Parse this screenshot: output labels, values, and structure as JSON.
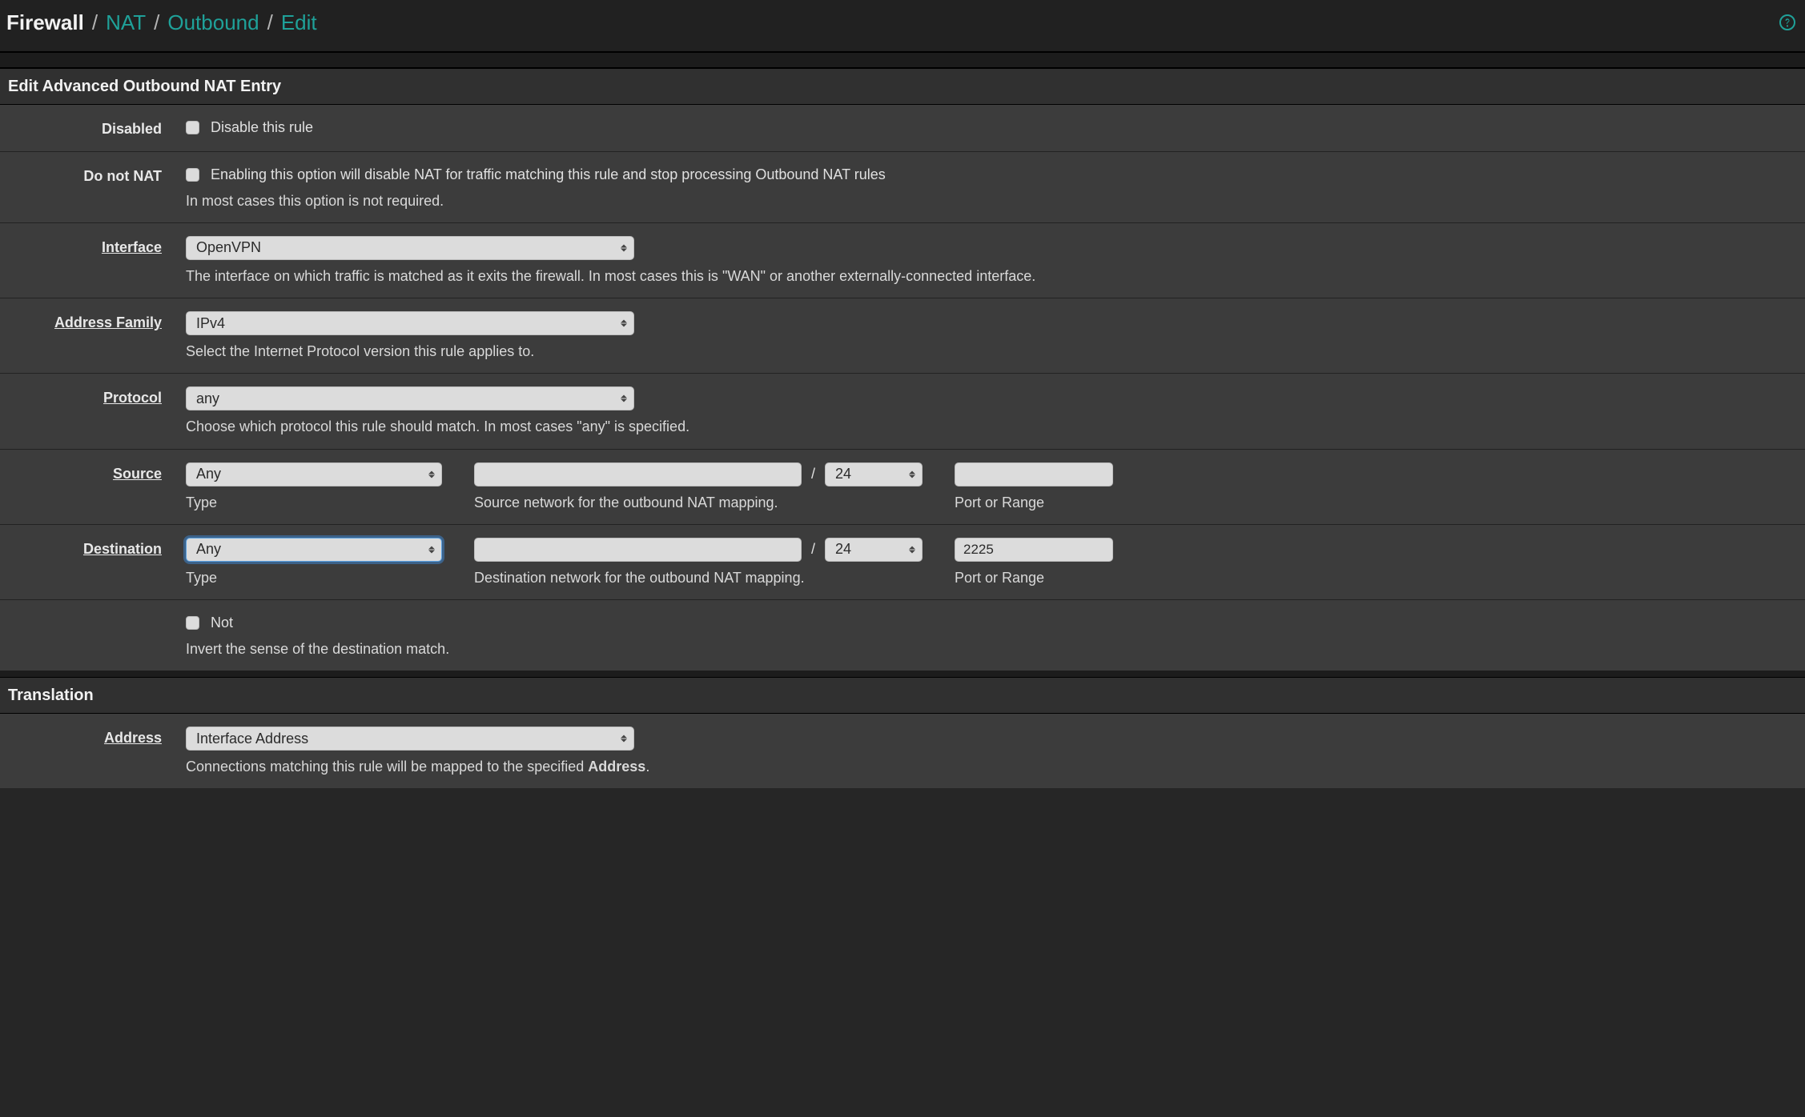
{
  "breadcrumb": {
    "root": "Firewall",
    "nat": "NAT",
    "outbound": "Outbound",
    "edit": "Edit",
    "sep": "/"
  },
  "panels": {
    "edit_entry": "Edit Advanced Outbound NAT Entry",
    "translation": "Translation"
  },
  "form": {
    "disabled": {
      "label": "Disabled",
      "check_label": "Disable this rule"
    },
    "do_not_nat": {
      "label": "Do not NAT",
      "check_label": "Enabling this option will disable NAT for traffic matching this rule and stop processing Outbound NAT rules",
      "help": "In most cases this option is not required."
    },
    "interface": {
      "label": "Interface",
      "value": "OpenVPN",
      "help": "The interface on which traffic is matched as it exits the firewall. In most cases this is \"WAN\" or another externally-connected interface."
    },
    "address_family": {
      "label": "Address Family",
      "value": "IPv4",
      "help": "Select the Internet Protocol version this rule applies to."
    },
    "protocol": {
      "label": "Protocol",
      "value": "any",
      "help": "Choose which protocol this rule should match. In most cases \"any\" is specified."
    },
    "source": {
      "label": "Source",
      "type_value": "Any",
      "type_sub": "Type",
      "network_value": "",
      "network_sub": "Source network for the outbound NAT mapping.",
      "mask_value": "24",
      "port_value": "",
      "port_sub": "Port or Range"
    },
    "destination": {
      "label": "Destination",
      "type_value": "Any",
      "type_sub": "Type",
      "network_value": "",
      "network_sub": "Destination network for the outbound NAT mapping.",
      "mask_value": "24",
      "port_value": "2225",
      "port_sub": "Port or Range"
    },
    "not": {
      "check_label": "Not",
      "help": "Invert the sense of the destination match."
    },
    "translation_address": {
      "label": "Address",
      "value": "Interface Address",
      "help_prefix": "Connections matching this rule will be mapped to the specified ",
      "help_bold": "Address",
      "help_suffix": "."
    }
  },
  "misc": {
    "slash": "/"
  }
}
